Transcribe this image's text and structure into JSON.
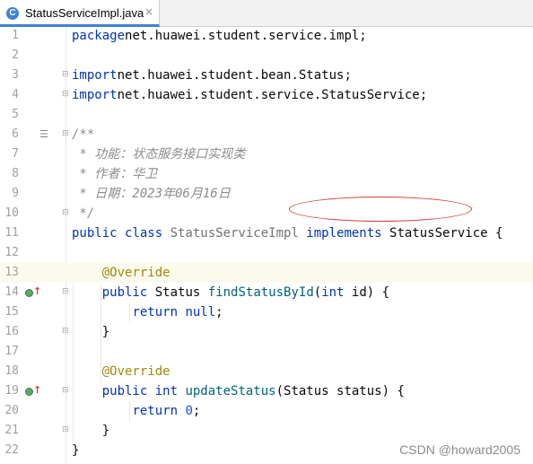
{
  "tab": {
    "icon_letter": "C",
    "label": "StatusServiceImpl.java",
    "close_symbol": "×"
  },
  "lines": [
    {
      "num": "1",
      "parts": [
        [
          "kw",
          "package"
        ],
        [
          "",
          "net.huawei.student.service.impl;"
        ]
      ]
    },
    {
      "num": "2",
      "parts": []
    },
    {
      "num": "3",
      "parts": [
        [
          "kw",
          "import"
        ],
        [
          "",
          "net.huawei.student.bean.Status;"
        ]
      ]
    },
    {
      "num": "4",
      "parts": [
        [
          "kw",
          "import"
        ],
        [
          "",
          "net.huawei.student.service.StatusService;"
        ]
      ]
    },
    {
      "num": "5",
      "parts": []
    },
    {
      "num": "6",
      "parts": [
        [
          "cm",
          "/**"
        ]
      ]
    },
    {
      "num": "7",
      "parts": [
        [
          "cm",
          " * 功能：状态服务接口实现类"
        ]
      ]
    },
    {
      "num": "8",
      "parts": [
        [
          "cm",
          " * 作者：华卫"
        ]
      ]
    },
    {
      "num": "9",
      "parts": [
        [
          "cm",
          " * 日期：2023年06月16日"
        ]
      ]
    },
    {
      "num": "10",
      "parts": [
        [
          "cm",
          " */"
        ]
      ]
    },
    {
      "num": "11",
      "parts": [
        [
          "kw",
          "public class "
        ],
        [
          "cls-gray",
          "StatusServiceImpl "
        ],
        [
          "kw",
          "implements "
        ],
        [
          "",
          "StatusService {"
        ]
      ]
    },
    {
      "num": "12",
      "parts": []
    },
    {
      "num": "13",
      "parts": [
        [
          "",
          "    "
        ],
        [
          "an",
          "@Override"
        ]
      ]
    },
    {
      "num": "14",
      "parts": [
        [
          "",
          "    "
        ],
        [
          "kw",
          "public "
        ],
        [
          "",
          "Status "
        ],
        [
          "fn",
          "findStatusById"
        ],
        [
          "",
          "("
        ],
        [
          "kw",
          "int "
        ],
        [
          "",
          "id) {"
        ]
      ]
    },
    {
      "num": "15",
      "parts": [
        [
          "",
          "        "
        ],
        [
          "kw",
          "return null"
        ],
        [
          "",
          ";"
        ]
      ]
    },
    {
      "num": "16",
      "parts": [
        [
          "",
          "    }"
        ]
      ]
    },
    {
      "num": "17",
      "parts": []
    },
    {
      "num": "18",
      "parts": [
        [
          "",
          "    "
        ],
        [
          "an",
          "@Override"
        ]
      ]
    },
    {
      "num": "19",
      "parts": [
        [
          "",
          "    "
        ],
        [
          "kw",
          "public int "
        ],
        [
          "fn",
          "updateStatus"
        ],
        [
          "",
          "(Status status) {"
        ]
      ]
    },
    {
      "num": "20",
      "parts": [
        [
          "",
          "        "
        ],
        [
          "kw",
          "return "
        ],
        [
          "num",
          "0"
        ],
        [
          "",
          ";"
        ]
      ]
    },
    {
      "num": "21",
      "parts": [
        [
          "",
          "    }"
        ]
      ]
    },
    {
      "num": "22",
      "parts": [
        [
          "",
          "}"
        ]
      ]
    }
  ],
  "current_line": "13",
  "impl_marker_lines": [
    "14",
    "19"
  ],
  "fold_marker_lines": [
    "3",
    "4",
    "6",
    "10",
    "14",
    "16",
    "19",
    "21"
  ],
  "doc_marker_lines": [
    "6"
  ],
  "watermark": "CSDN @howard2005",
  "colors": {
    "keyword": "#0033b3",
    "comment": "#8c8c8c",
    "annotation": "#9e880d",
    "method": "#00627a",
    "highlight_circle": "#d83a3a"
  }
}
